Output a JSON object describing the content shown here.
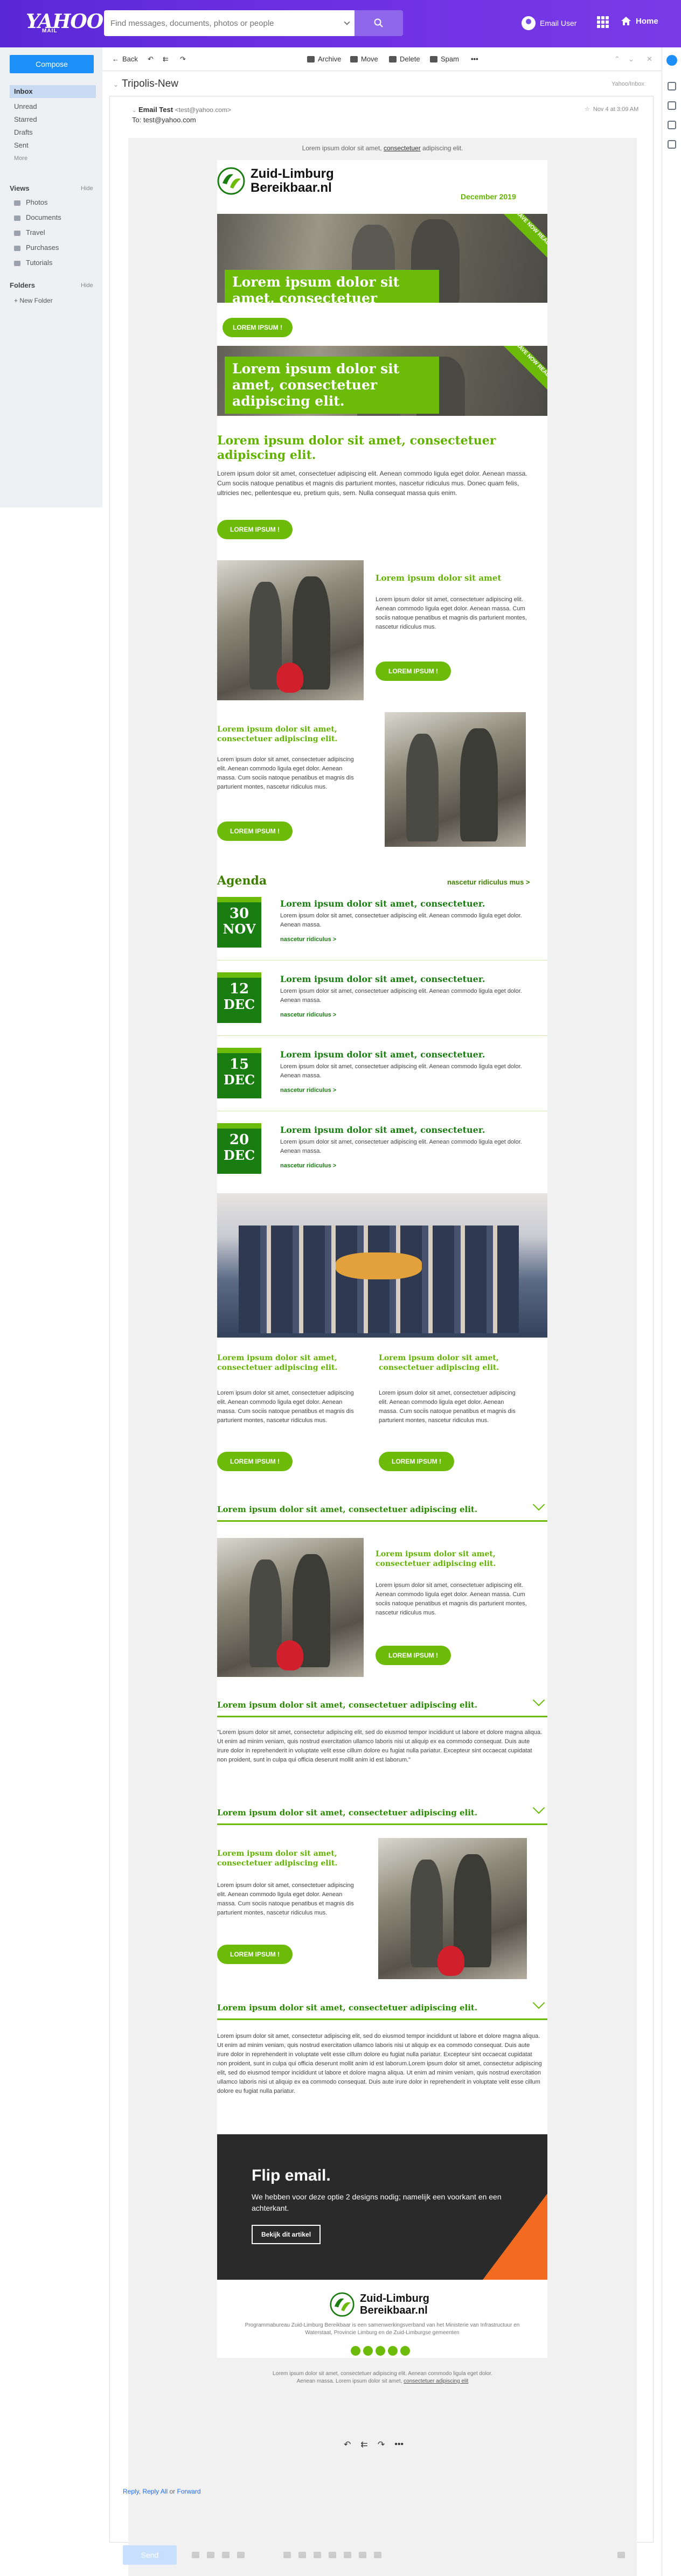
{
  "app": {
    "logo": "YAHOO!",
    "logo_sub": "MAIL",
    "search_placeholder": "Find messages, documents, photos or people",
    "user_name": "Email User",
    "home_label": "Home"
  },
  "sidebar": {
    "compose_label": "Compose",
    "folders": [
      "Inbox",
      "Unread",
      "Starred",
      "Drafts",
      "Sent",
      "More"
    ],
    "views_label": "Views",
    "views_hide": "Hide",
    "views": [
      "Photos",
      "Documents",
      "Travel",
      "Purchases",
      "Tutorials"
    ],
    "folders_label": "Folders",
    "folders_hide": "Hide",
    "new_folder": "+ New Folder"
  },
  "toolbar": {
    "back": "Back",
    "archive": "Archive",
    "move": "Move",
    "delete": "Delete",
    "spam": "Spam",
    "more": "•••"
  },
  "message": {
    "subject": "Tripolis-New",
    "folder_label": "Yahoo/Inbox",
    "from_name": "Email Test",
    "from_address": "<test@yahoo.com>",
    "to_label": "To:",
    "to_address": "test@yahoo.com",
    "date": "Nov 4 at 3:09 AM"
  },
  "newsletter": {
    "preheader_before": "Lorem ipsum dolor sit amet,",
    "preheader_link": "consectetuer",
    "preheader_after": "adipiscing elit.",
    "brand_line1": "Zuid-Limburg",
    "brand_line2": "Bereikbaar.nl",
    "issue_date": "December 2019",
    "hero1": {
      "title": "Lorem ipsum dolor sit amet, consectetuer adipiscing elit.",
      "button": "LOREM IPSUM !",
      "ribbon": "HAVE NOW READ"
    },
    "hero2": {
      "title": "Lorem ipsum dolor sit amet, consectetuer adipiscing elit.",
      "ribbon": "HAVE NOW READ"
    },
    "intro": {
      "title": "Lorem ipsum dolor sit amet, consectetuer adipiscing elit.",
      "body": "Lorem ipsum dolor sit amet, consectetuer adipiscing elit. Aenean commodo ligula eget dolor. Aenean massa. Cum sociis natoque penatibus et magnis dis parturient montes, nascetur ridiculus mus. Donec quam felis, ultricies nec, pellentesque eu, pretium quis, sem. Nulla consequat massa quis enim.",
      "button": "LOREM IPSUM !"
    },
    "feature1": {
      "title": "Lorem ipsum dolor sit amet",
      "body": "Lorem ipsum dolor sit amet, consectetuer adipiscing elit. Aenean commodo ligula eget dolor. Aenean massa. Cum sociis natoque penatibus et magnis dis parturient montes, nascetur ridiculus mus.",
      "button": "LOREM IPSUM !"
    },
    "feature2": {
      "title": "Lorem ipsum dolor sit amet, consectetuer adipiscing elit.",
      "body": "Lorem ipsum dolor sit amet, consectetuer adipiscing elit. Aenean commodo ligula eget dolor. Aenean massa. Cum sociis natoque penatibus et magnis dis parturient montes, nascetur ridiculus mus.",
      "button": "LOREM IPSUM !"
    },
    "agenda": {
      "title": "Agenda",
      "more": "nascetur ridiculus mus >",
      "items": [
        {
          "day": "30",
          "month": "NOV",
          "title": "Lorem ipsum dolor sit amet, consectetuer.",
          "body": "Lorem ipsum dolor sit amet, consectetuer adipiscing elit. Aenean commodo ligula eget dolor. Aenean massa.",
          "more": "nascetur ridiculus >"
        },
        {
          "day": "12",
          "month": "DEC",
          "title": "Lorem ipsum dolor sit amet, consectetuer.",
          "body": "Lorem ipsum dolor sit amet, consectetuer adipiscing elit. Aenean commodo ligula eget dolor. Aenean massa.",
          "more": "nascetur ridiculus >"
        },
        {
          "day": "15",
          "month": "DEC",
          "title": "Lorem ipsum dolor sit amet, consectetuer.",
          "body": "Lorem ipsum dolor sit amet, consectetuer adipiscing elit. Aenean commodo ligula eget dolor. Aenean massa.",
          "more": "nascetur ridiculus >"
        },
        {
          "day": "20",
          "month": "DEC",
          "title": "Lorem ipsum dolor sit amet, consectetuer.",
          "body": "Lorem ipsum dolor sit amet, consectetuer adipiscing elit. Aenean commodo ligula eget dolor. Aenean massa.",
          "more": "nascetur ridiculus >"
        }
      ]
    },
    "cols": [
      {
        "title": "Lorem ipsum dolor sit amet, consectetuer adipiscing elit.",
        "body": "Lorem ipsum dolor sit amet, consectetuer adipiscing elit. Aenean commodo ligula eget dolor. Aenean massa. Cum sociis natoque penatibus et magnis dis parturient montes, nascetur ridiculus mus.",
        "button": "LOREM IPSUM !"
      },
      {
        "title": "Lorem ipsum dolor sit amet, consectetuer adipiscing elit.",
        "body": "Lorem ipsum dolor sit amet, consectetuer adipiscing elit. Aenean commodo ligula eget dolor. Aenean massa. Cum sociis natoque penatibus et magnis dis parturient montes, nascetur ridiculus mus.",
        "button": "LOREM IPSUM !"
      }
    ],
    "accordion1": "Lorem ipsum dolor sit amet, consectetuer adipiscing elit.",
    "feature3": {
      "title": "Lorem ipsum dolor sit amet, consectetuer adipiscing elit.",
      "body": "Lorem ipsum dolor sit amet, consectetuer adipiscing elit. Aenean commodo ligula eget dolor. Aenean massa. Cum sociis natoque penatibus et magnis dis parturient montes, nascetur ridiculus mus.",
      "button": "LOREM IPSUM !"
    },
    "accordion2": "Lorem ipsum dolor sit amet, consectetuer adipiscing elit.",
    "quote": "\"Lorem ipsum dolor sit amet, consectetur adipiscing elit, sed do eiusmod tempor incididunt ut labore et dolore magna aliqua. Ut enim ad minim veniam, quis nostrud exercitation ullamco laboris nisi ut aliquip ex ea commodo consequat. Duis aute irure dolor in reprehenderit in voluptate velit esse cillum dolore eu fugiat nulla pariatur. Excepteur sint occaecat cupidatat non proident, sunt in culpa qui officia deserunt mollit anim id est laborum.\"",
    "accordion3": "Lorem ipsum dolor sit amet, consectetuer adipiscing elit.",
    "feature4": {
      "title": "Lorem ipsum dolor sit amet, consectetuer adipiscing elit.",
      "body": "Lorem ipsum dolor sit amet, consectetuer adipiscing elit. Aenean commodo ligula eget dolor. Aenean massa. Cum sociis natoque penatibus et magnis dis parturient montes, nascetur ridiculus mus.",
      "button": "LOREM IPSUM !"
    },
    "accordion4": "Lorem ipsum dolor sit amet, consectetuer adipiscing elit.",
    "longtext": "Lorem ipsum dolor sit amet, consectetur adipiscing elit, sed do eiusmod tempor incididunt ut labore et dolore magna aliqua. Ut enim ad minim veniam, quis nostrud exercitation ullamco laboris nisi ut aliquip ex ea commodo consequat. Duis aute irure dolor in reprehenderit in voluptate velit esse cillum dolore eu fugiat nulla pariatur. Excepteur sint occaecat cupidatat non proident, sunt in culpa qui officia deserunt mollit anim id est laborum.Lorem ipsum dolor sit amet, consectetur adipiscing elit, sed do eiusmod tempor incididunt ut labore et dolore magna aliqua. Ut enim ad minim veniam, quis nostrud exercitation ullamco laboris nisi ut aliquip ex ea commodo consequat. Duis aute irure dolor in reprehenderit in voluptate velit esse cillum dolore eu fugiat nulla pariatur.",
    "flip": {
      "title": "Flip email.",
      "body": "We hebben voor deze optie 2 designs nodig; namelijk een voorkant en een achterkant.",
      "button": "Bekijk dit artikel"
    },
    "footer": "Programmabureau Zuid-Limburg Bereikbaar is een samenwerkingsverband van het Ministerie van Infrastructuur en Waterstaat, Provincie Limburg en de Zuid-Limburgse gemeenten",
    "bottom_text": "Lorem ipsum dolor sit amet, consectetuer adipiscing elit. Aenean commodo ligula eget dolor. Aenean massa. Lorem ipsum dolor sit amet,",
    "bottom_link": "consectetuer adipiscing elit"
  },
  "reply": {
    "reply": "Reply",
    "reply_all": "Reply All",
    "or": "or",
    "forward": "Forward"
  },
  "compose_bar": {
    "send": "Send"
  },
  "colors": {
    "accent_green": "#6cbb09",
    "dark_green": "#1a7d11",
    "yahoo_purple": "#6b2fe0",
    "compose_blue": "#1d8ff9",
    "flip_orange": "#f26b21"
  }
}
